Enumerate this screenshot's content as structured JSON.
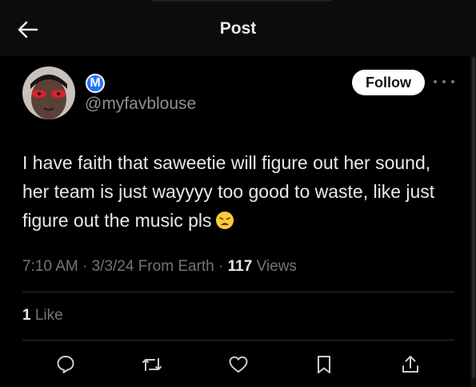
{
  "header": {
    "title": "Post",
    "back_icon": "arrow-left-icon"
  },
  "author": {
    "badge_letter": "M",
    "badge_color": "#1d72ff",
    "handle": "@myfavblouse",
    "follow_label": "Follow",
    "more_icon": "more-horizontal-icon"
  },
  "post": {
    "text": "I have faith that saweetie will figure out her sound, her team is just wayyyy too good to waste, like just figure out the music pls",
    "emoji_icon": "weary-face-emoji"
  },
  "meta": {
    "time": "7:10 AM",
    "date": "3/3/24",
    "source": "From Earth",
    "views_count": "117",
    "views_label": "Views"
  },
  "engagement": {
    "likes_count": "1",
    "likes_label": "Like"
  },
  "actions": {
    "reply_icon": "reply-icon",
    "repost_icon": "repost-icon",
    "like_icon": "heart-icon",
    "bookmark_icon": "bookmark-icon",
    "share_icon": "share-icon"
  },
  "colors": {
    "background": "#000000",
    "text_primary": "#e7e9ea",
    "text_secondary": "#71767b"
  }
}
